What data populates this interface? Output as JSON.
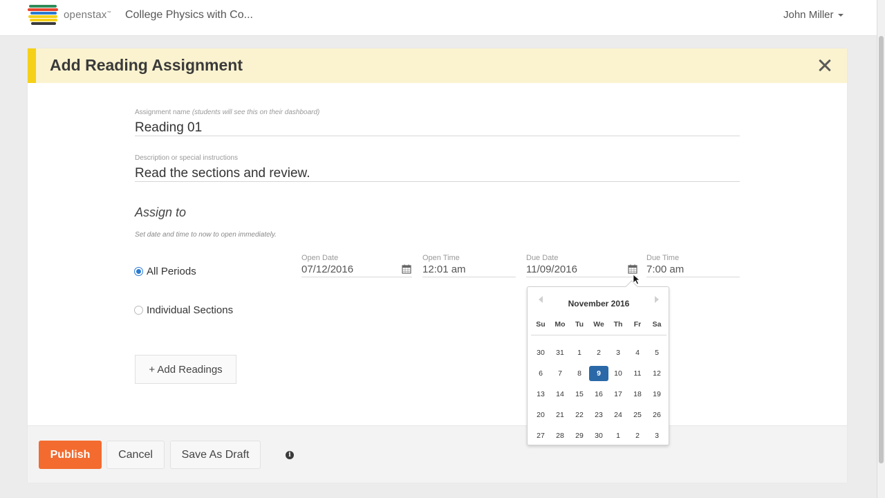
{
  "navbar": {
    "brand": "openstax",
    "brand_tm": "™",
    "course_title": "College Physics with Co...",
    "user_name": "John Miller",
    "logo_colors": [
      "#2e8b57",
      "#e8442e",
      "#f5d019",
      "#2a7ad2",
      "#3a3a3a"
    ]
  },
  "modal": {
    "title": "Add Reading Assignment",
    "name_label": "Assignment name",
    "name_hint": "(students will see this on their dashboard)",
    "name_value": "Reading 01",
    "desc_label": "Description or special instructions",
    "desc_value": "Read the sections and review.",
    "assign_heading": "Assign to",
    "assign_hint": "Set date and time to now to open immediately.",
    "radio_all": "All Periods",
    "radio_individual": "Individual Sections",
    "selected_radio": "All Periods",
    "open_date_label": "Open Date",
    "open_date": "07/12/2016",
    "open_time_label": "Open Time",
    "open_time": "12:01 am",
    "due_date_label": "Due Date",
    "due_date": "11/09/2016",
    "due_time_label": "Due Time",
    "due_time": "7:00 am",
    "add_readings": "+ Add Readings"
  },
  "footer": {
    "publish": "Publish",
    "cancel": "Cancel",
    "save_draft": "Save As Draft",
    "info_glyph": "i"
  },
  "datepicker": {
    "month_label": "November 2016",
    "weekdays": [
      "Su",
      "Mo",
      "Tu",
      "We",
      "Th",
      "Fr",
      "Sa"
    ],
    "weeks": [
      [
        "30",
        "31",
        "1",
        "2",
        "3",
        "4",
        "5"
      ],
      [
        "6",
        "7",
        "8",
        "9",
        "10",
        "11",
        "12"
      ],
      [
        "13",
        "14",
        "15",
        "16",
        "17",
        "18",
        "19"
      ],
      [
        "20",
        "21",
        "22",
        "23",
        "24",
        "25",
        "26"
      ],
      [
        "27",
        "28",
        "29",
        "30",
        "1",
        "2",
        "3"
      ]
    ],
    "selected_day": "9"
  },
  "colors": {
    "accent_orange": "#f36b2f",
    "header_yellow": "#fbf3cf",
    "header_stripe": "#f5d019",
    "selected_blue": "#2a68a8"
  }
}
